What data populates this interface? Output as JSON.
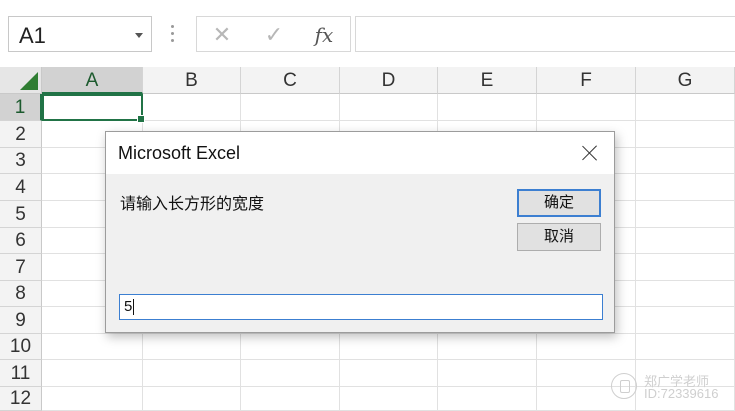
{
  "formula_bar": {
    "name_box": "A1",
    "name_box_arrow_icon": "chevron-down-icon",
    "cancel_icon": "✕",
    "enter_icon": "✓",
    "fx_icon": "fx",
    "formula_value": ""
  },
  "grid": {
    "columns": [
      "A",
      "B",
      "C",
      "D",
      "E",
      "F",
      "G"
    ],
    "rows": [
      "1",
      "2",
      "3",
      "4",
      "5",
      "6",
      "7",
      "8",
      "9",
      "10",
      "11",
      "12"
    ],
    "selected_cell": "A1"
  },
  "dialog": {
    "title": "Microsoft Excel",
    "prompt": "请输入长方形的宽度",
    "ok_label": "确定",
    "cancel_label": "取消",
    "input_value": "5"
  },
  "watermark": {
    "line1": "郑广学老师",
    "line2": "ID:72339616"
  },
  "colors": {
    "accent_green": "#217346",
    "focus_blue": "#3c7fd1"
  }
}
